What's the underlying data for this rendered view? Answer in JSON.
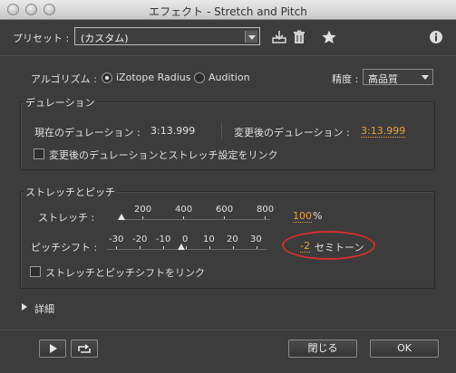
{
  "window": {
    "title": "エフェクト - Stretch and Pitch"
  },
  "preset": {
    "label": "プリセット :",
    "value": "(カスタム)"
  },
  "algorithm": {
    "label": "アルゴリズム :",
    "options": [
      {
        "label": "iZotope Radius",
        "selected": true
      },
      {
        "label": "Audition",
        "selected": false
      }
    ]
  },
  "precision": {
    "label": "精度 :",
    "value": "高品質"
  },
  "duration": {
    "group_title": "デュレーション",
    "current_label": "現在のデュレーション :",
    "current_value": "3:13.999",
    "new_label": "変更後のデュレーション :",
    "new_value": "3:13.999",
    "link_checkbox_label": "変更後のデュレーションとストレッチ設定をリンク"
  },
  "stretch_pitch": {
    "group_title": "ストレッチとピッチ",
    "stretch_label": "ストレッチ :",
    "stretch_ticks": [
      "200",
      "400",
      "600",
      "800"
    ],
    "stretch_value": "100",
    "stretch_unit": "%",
    "pitch_label": "ピッチシフト :",
    "pitch_ticks": [
      "-30",
      "-20",
      "-10",
      "0",
      "10",
      "20",
      "30"
    ],
    "pitch_value": "-2",
    "pitch_unit": "セミトーン",
    "link_checkbox_label": "ストレッチとピッチシフトをリンク"
  },
  "advanced": {
    "label": "詳細"
  },
  "buttons": {
    "close": "閉じる",
    "ok": "OK"
  },
  "colors": {
    "accent_value": "#e8a23a",
    "annotation": "#d03030"
  }
}
